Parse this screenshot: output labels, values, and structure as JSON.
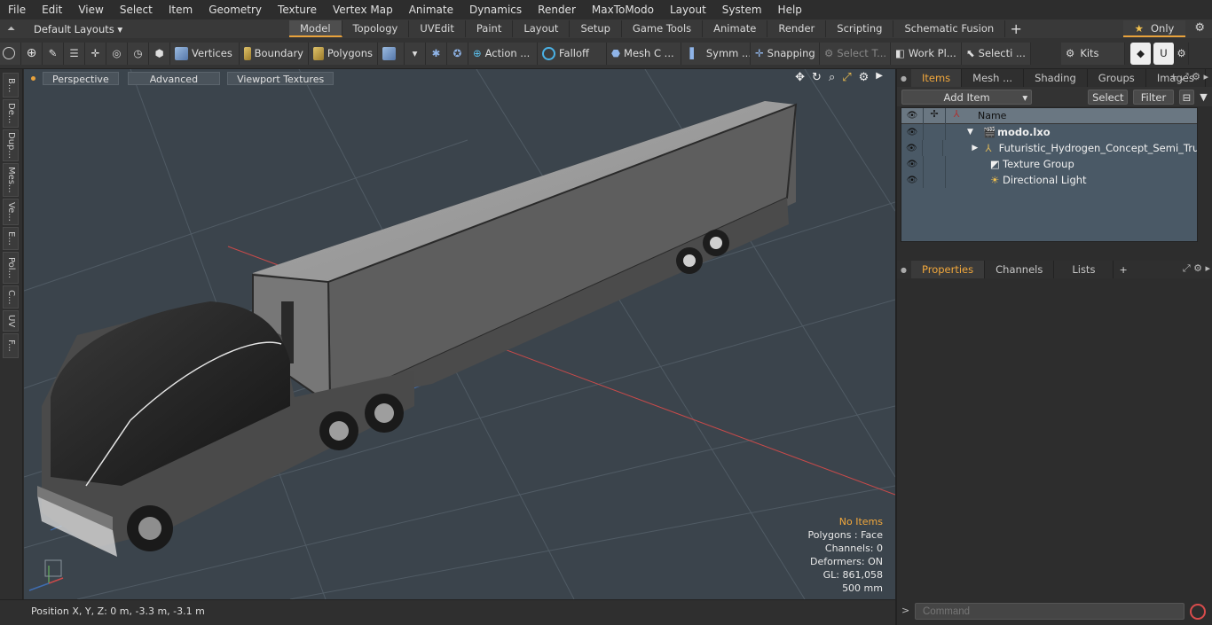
{
  "menu": [
    "File",
    "Edit",
    "View",
    "Select",
    "Item",
    "Geometry",
    "Texture",
    "Vertex Map",
    "Animate",
    "Dynamics",
    "Render",
    "MaxToModo",
    "Layout",
    "System",
    "Help"
  ],
  "layouts_label": "Default Layouts ▾",
  "tabs": [
    "Model",
    "Topology",
    "UVEdit",
    "Paint",
    "Layout",
    "Setup",
    "Game Tools",
    "Animate",
    "Render",
    "Scripting",
    "Schematic Fusion"
  ],
  "active_tab": "Model",
  "only_label": "Only",
  "toolbar": {
    "vertices": "Vertices",
    "boundary": "Boundary",
    "polygons": "Polygons",
    "action": "Action ...",
    "falloff": "Falloff",
    "mesh": "Mesh C ...",
    "symm": "Symm ...",
    "snapping": "Snapping",
    "select_t": "Select T...",
    "work_plane": "Work Pl...",
    "selecti": "Selecti ...",
    "kits": "Kits"
  },
  "left_tabs": [
    "B...",
    "De...",
    "Dup...",
    "Mes...",
    "Ve...",
    "E...",
    "Pol...",
    "C...",
    "UV",
    "F..."
  ],
  "viewport": {
    "perspective": "Perspective",
    "advanced": "Advanced",
    "viewport_textures": "Viewport Textures",
    "stats": {
      "no_items": "No Items",
      "polygons": "Polygons : Face",
      "channels": "Channels: 0",
      "deformers": "Deformers: ON",
      "gl": "GL: 861,058",
      "size": "500 mm"
    }
  },
  "status": "Position X, Y, Z:   0 m, -3.3 m, -3.1 m",
  "right_panel": {
    "tabs": [
      "Items",
      "Mesh ...",
      "Shading",
      "Groups",
      "Images"
    ],
    "add_item": "Add Item",
    "select": "Select",
    "filter": "Filter",
    "name_header": "Name",
    "tree": [
      {
        "label": "modo.lxo",
        "bold": true
      },
      {
        "label": "Futuristic_Hydrogen_Concept_Semi_Tru..."
      },
      {
        "label": "Texture Group"
      },
      {
        "label": "Directional Light"
      }
    ],
    "props_tabs": [
      "Properties",
      "Channels",
      "Lists"
    ],
    "command_placeholder": "Command"
  }
}
